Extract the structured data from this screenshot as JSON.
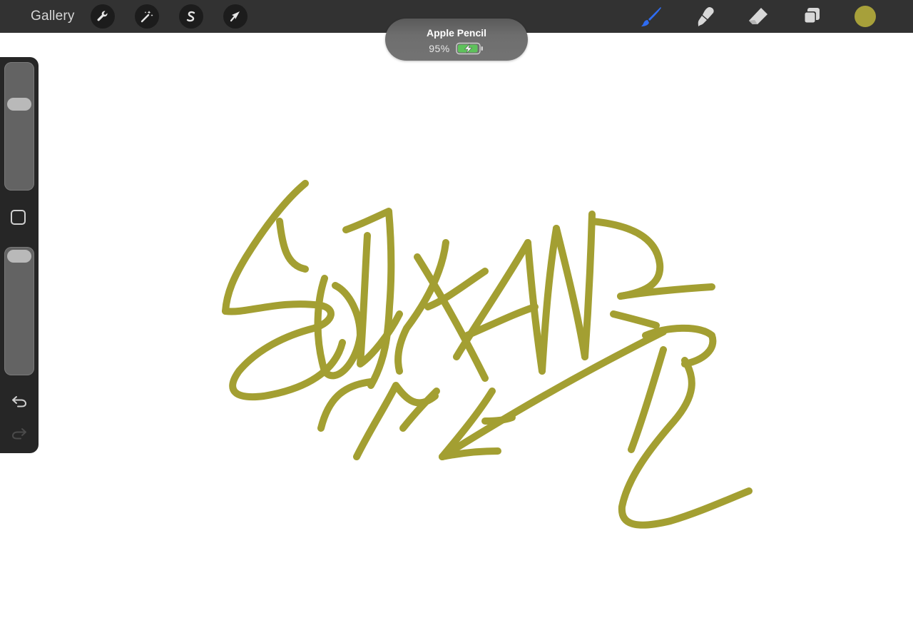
{
  "topbar": {
    "gallery_label": "Gallery",
    "left_tools": [
      {
        "name": "wrench-icon"
      },
      {
        "name": "magic-wand-icon"
      },
      {
        "name": "selection-s-icon"
      },
      {
        "name": "transform-arrow-icon"
      }
    ],
    "right_tools": [
      {
        "name": "brush-icon",
        "active": true
      },
      {
        "name": "smudge-icon"
      },
      {
        "name": "eraser-icon"
      },
      {
        "name": "layers-icon"
      }
    ],
    "current_color": "#a7a03a",
    "active_tool_color": "#2e6cf2"
  },
  "apple_pencil": {
    "title": "Apple Pencil",
    "battery_percent_text": "95%",
    "battery_level": 0.95,
    "battery_color": "#5ec25b"
  },
  "sidebar": {
    "brush_size_level": 0.3,
    "opacity_level": 1.0,
    "icons": [
      "modify-square-icon",
      "undo-icon",
      "redo-icon"
    ]
  },
  "canvas": {
    "stroke_color": "#a39f32",
    "background": "#ffffff"
  }
}
